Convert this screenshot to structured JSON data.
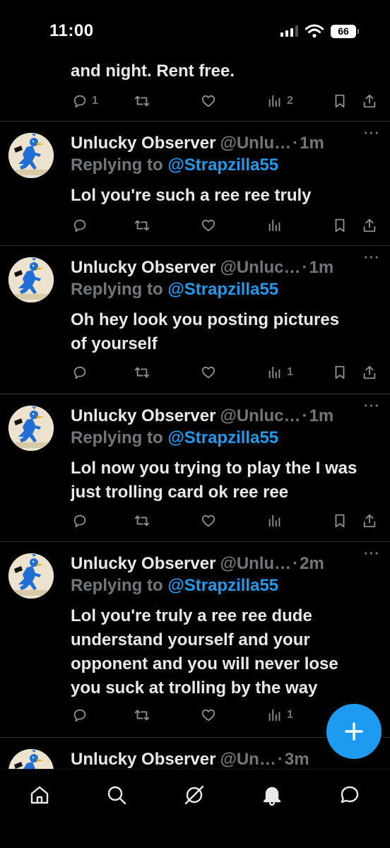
{
  "status_bar": {
    "time": "11:00",
    "battery": "66"
  },
  "tweets": [
    {
      "body_lines": [
        "and night. Rent free."
      ],
      "counts": {
        "replies": "1",
        "retweets": "",
        "likes": "",
        "views": "2"
      }
    },
    {
      "name": "Unlucky Observer",
      "handle": "@Unlu…",
      "time": "1m",
      "replying_prefix": "Replying to ",
      "replying_to": "@Strapzilla55",
      "body_lines": [
        "Lol you're such a ree ree truly"
      ],
      "counts": {
        "replies": "",
        "retweets": "",
        "likes": "",
        "views": ""
      }
    },
    {
      "name": "Unlucky Observer",
      "handle": "@Unluc…",
      "time": "1m",
      "replying_prefix": "Replying to ",
      "replying_to": "@Strapzilla55",
      "body_lines": [
        "Oh hey look you posting pictures",
        "of yourself"
      ],
      "counts": {
        "replies": "",
        "retweets": "",
        "likes": "",
        "views": "1"
      }
    },
    {
      "name": "Unlucky Observer",
      "handle": "@Unluc…",
      "time": "1m",
      "replying_prefix": "Replying to ",
      "replying_to": "@Strapzilla55",
      "body_lines": [
        "Lol now you trying to play the I was",
        "just trolling card ok ree ree"
      ],
      "counts": {
        "replies": "",
        "retweets": "",
        "likes": "",
        "views": ""
      }
    },
    {
      "name": "Unlucky Observer",
      "handle": "@Unlu…",
      "time": "2m",
      "replying_prefix": "Replying to ",
      "replying_to": "@Strapzilla55",
      "body_lines": [
        "Lol you're truly a ree ree dude",
        "understand yourself and your",
        "opponent and you will never lose",
        "you suck at trolling by the way"
      ],
      "counts": {
        "replies": "",
        "retweets": "",
        "likes": "",
        "views": "1"
      }
    },
    {
      "name": "Unlucky Observer",
      "handle": "@Un…",
      "time": "3m"
    }
  ],
  "dot_separator": "·",
  "more_label": "···",
  "colors": {
    "background": "#000000",
    "accent": "#1d9bf0",
    "muted": "#71767b",
    "divider": "#2f3336"
  },
  "icons": {
    "actions": [
      "reply-icon",
      "retweet-icon",
      "like-icon",
      "views-icon",
      "bookmark-icon",
      "share-icon"
    ],
    "nav": [
      "home-icon",
      "search-icon",
      "grok-icon",
      "notifications-icon",
      "messages-icon"
    ],
    "fab": "plus-icon"
  }
}
